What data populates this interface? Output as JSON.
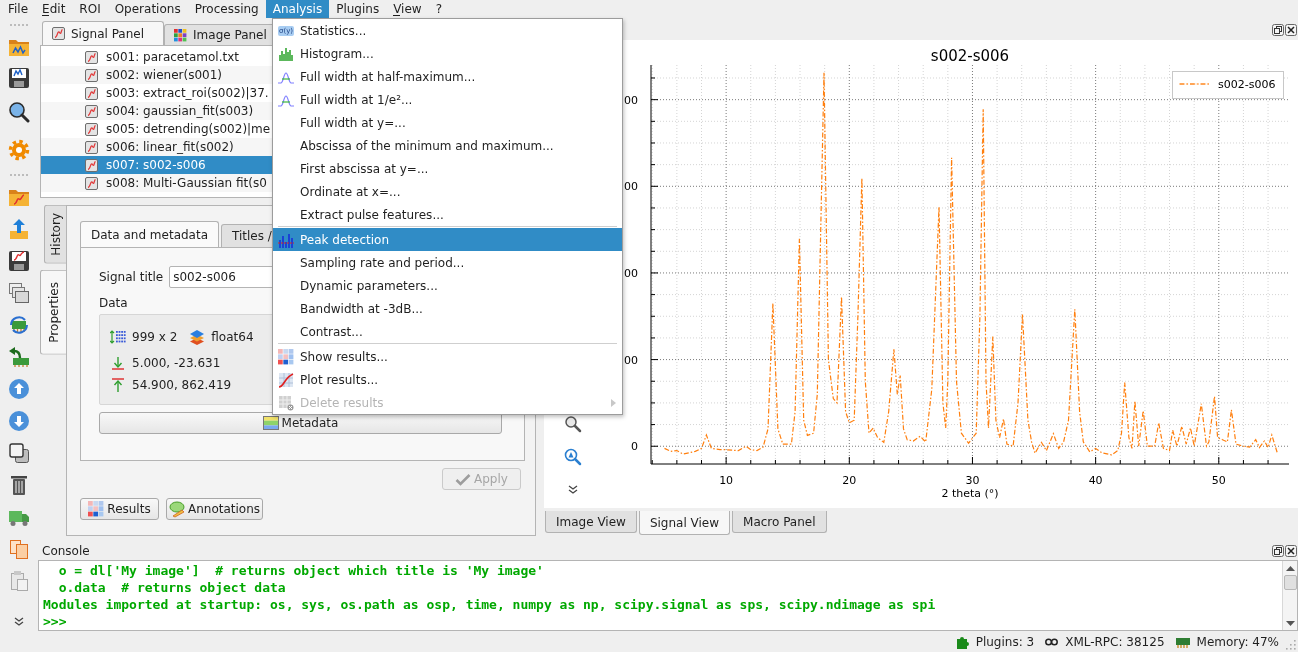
{
  "menubar": [
    {
      "label": "File",
      "mnemonic": false,
      "selected": false
    },
    {
      "label": "Edit",
      "mnemonic": true,
      "selected": false
    },
    {
      "label": "ROI",
      "mnemonic": false,
      "selected": false
    },
    {
      "label": "Operations",
      "mnemonic": false,
      "selected": false
    },
    {
      "label": "Processing",
      "mnemonic": false,
      "selected": false
    },
    {
      "label": "Analysis",
      "mnemonic": false,
      "selected": true
    },
    {
      "label": "Plugins",
      "mnemonic": false,
      "selected": false
    },
    {
      "label": "View",
      "mnemonic": true,
      "selected": false
    },
    {
      "label": "?",
      "mnemonic": false,
      "selected": false
    }
  ],
  "analysis_menu": {
    "sections": [
      [
        {
          "label": "Statistics...",
          "kind": "statistics",
          "badge": "σ(y)",
          "selected": false,
          "disabled": false,
          "submenu": false
        },
        {
          "label": "Histogram...",
          "kind": "histogram",
          "selected": false,
          "disabled": false,
          "submenu": false
        },
        {
          "label": "Full width at half-maximum...",
          "kind": "width",
          "selected": false,
          "disabled": false,
          "submenu": false
        },
        {
          "label": "Full width at 1/e²...",
          "kind": "width",
          "selected": false,
          "disabled": false,
          "submenu": false
        },
        {
          "label": "Full width at y=...",
          "kind": "plain",
          "selected": false,
          "disabled": false,
          "submenu": false
        },
        {
          "label": "Abscissa of the minimum and maximum...",
          "kind": "plain",
          "selected": false,
          "disabled": false,
          "submenu": false
        },
        {
          "label": "First abscissa at y=...",
          "kind": "plain",
          "selected": false,
          "disabled": false,
          "submenu": false
        },
        {
          "label": "Ordinate at x=...",
          "kind": "plain",
          "selected": false,
          "disabled": false,
          "submenu": false
        },
        {
          "label": "Extract pulse features...",
          "kind": "plain",
          "selected": false,
          "disabled": false,
          "submenu": false
        }
      ],
      [
        {
          "label": "Peak detection",
          "kind": "peaks",
          "selected": true,
          "disabled": false,
          "submenu": false
        },
        {
          "label": "Sampling rate and period...",
          "kind": "plain",
          "selected": false,
          "disabled": false,
          "submenu": false
        },
        {
          "label": "Dynamic parameters...",
          "kind": "plain",
          "selected": false,
          "disabled": false,
          "submenu": false
        },
        {
          "label": "Bandwidth at -3dB...",
          "kind": "plain",
          "selected": false,
          "disabled": false,
          "submenu": false
        },
        {
          "label": "Contrast...",
          "kind": "plain",
          "selected": false,
          "disabled": false,
          "submenu": false
        }
      ],
      [
        {
          "label": "Show results...",
          "kind": "results",
          "selected": false,
          "disabled": false,
          "submenu": false
        },
        {
          "label": "Plot results...",
          "kind": "plot",
          "selected": false,
          "disabled": false,
          "submenu": false
        },
        {
          "label": "Delete results",
          "kind": "delete",
          "selected": false,
          "disabled": true,
          "submenu": true
        }
      ]
    ]
  },
  "signal_panel": {
    "tabs": [
      {
        "label": "Signal Panel",
        "kind": "signal",
        "selected": true
      },
      {
        "label": "Image Panel",
        "kind": "image",
        "selected": false
      }
    ],
    "items": [
      {
        "label": "s001: paracetamol.txt",
        "selected": false
      },
      {
        "label": "s002: wiener(s001)",
        "selected": false
      },
      {
        "label": "s003: extract_roi(s002)|37.",
        "selected": false
      },
      {
        "label": "s004: gaussian_fit(s003)",
        "selected": false
      },
      {
        "label": "s005: detrending(s002)|me",
        "selected": false
      },
      {
        "label": "s006: linear_fit(s002)",
        "selected": false
      },
      {
        "label": "s007: s002-s006",
        "selected": true
      },
      {
        "label": "s008: Multi-Gaussian fit(s0",
        "selected": false
      }
    ]
  },
  "side_tabs": [
    {
      "label": "History",
      "selected": false
    },
    {
      "label": "Properties",
      "selected": true
    }
  ],
  "properties": {
    "tabs": [
      {
        "label": "Data and metadata",
        "selected": true
      },
      {
        "label": "Titles /",
        "selected": false
      }
    ],
    "title_label": "Signal title",
    "title_value": "s002-s006",
    "data_label": "Data",
    "shape": "999 x 2",
    "dtype": "float64",
    "min_point": "5.000, -23.631",
    "max_point": "54.900, 862.419",
    "metadata_button": "Metadata",
    "apply_button": {
      "label": "Apply",
      "disabled": true
    },
    "buttons": [
      {
        "label": "Results",
        "kind": "results"
      },
      {
        "label": "Annotations",
        "kind": "annotations"
      }
    ]
  },
  "plot": {
    "title": "s002-s006",
    "y_tick_labels": [
      "00",
      "00",
      "00",
      "00",
      "0"
    ],
    "x_tick_labels": [
      "10",
      "20",
      "30",
      "40",
      "50"
    ],
    "x_axis_title": "2 theta (°)",
    "legend": [
      {
        "label": "s002-s006",
        "color": "#ff7f0e",
        "kind": "dash_dot"
      }
    ]
  },
  "view_tabs": [
    {
      "label": "Image View",
      "selected": false
    },
    {
      "label": "Signal View",
      "selected": true
    },
    {
      "label": "Macro Panel",
      "selected": false
    }
  ],
  "console": {
    "title": "Console",
    "lines": [
      "  o = dl['My image']  # returns object which title is 'My image'",
      "  o.data  # returns object data",
      "Modules imported at startup: os, sys, os.path as osp, time, numpy as np, scipy.signal as sps, scipy.ndimage as spi",
      ">>>"
    ]
  },
  "status_bar": [
    {
      "kind": "plugins",
      "label": "Plugins: 3"
    },
    {
      "kind": "xmlrpc",
      "label": "XML-RPC: 38125"
    },
    {
      "kind": "memory",
      "label": "Memory: 47%"
    }
  ]
}
